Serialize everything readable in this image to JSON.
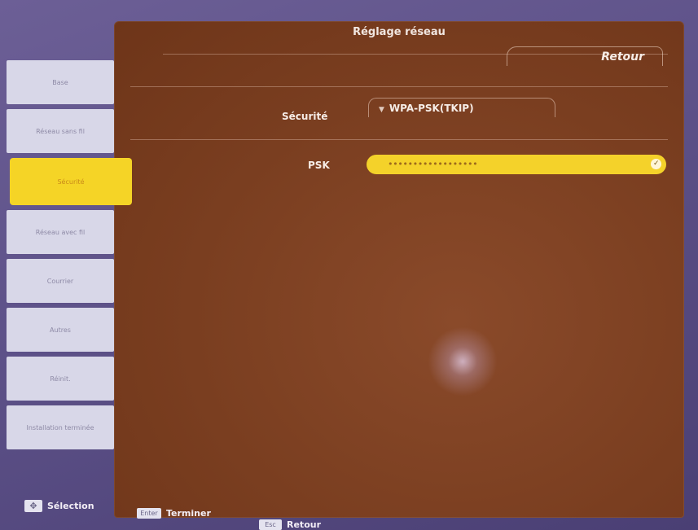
{
  "panel": {
    "title": "Réglage réseau",
    "back_label": "Retour"
  },
  "fields": {
    "security_label": "Sécurité",
    "security_value": "WPA-PSK(TKIP)",
    "psk_label": "PSK",
    "psk_value": "••••••••••••••••••"
  },
  "sidebar": {
    "items": [
      {
        "label": "Base"
      },
      {
        "label": "Réseau sans fil"
      },
      {
        "label": "Sécurité"
      },
      {
        "label": "Réseau avec fil"
      },
      {
        "label": "Courrier"
      },
      {
        "label": "Autres"
      },
      {
        "label": "Réinit."
      },
      {
        "label": "Installation terminée"
      }
    ]
  },
  "footer": {
    "select_label": "Sélection",
    "select_key": "✥",
    "finish_label": "Terminer",
    "finish_key": "Enter",
    "back_label": "Retour",
    "back_key": "Esc"
  },
  "colors": {
    "panel": "#7a3e20",
    "accent": "#f5d426",
    "background": "#5d5188"
  }
}
